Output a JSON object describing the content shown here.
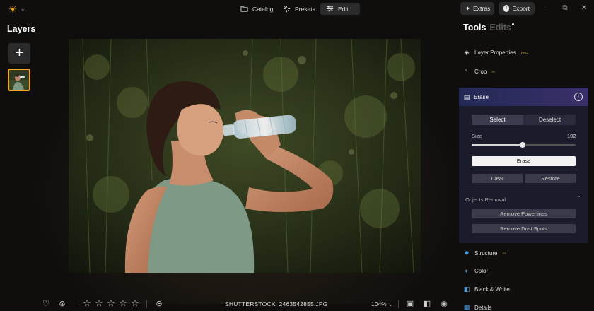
{
  "top_bar": {
    "tabs": [
      {
        "label": "Catalog",
        "icon": "folder-icon"
      },
      {
        "label": "Presets",
        "icon": "sparkle-icon"
      },
      {
        "label": "Edit",
        "icon": "sliders-icon",
        "active": true
      }
    ],
    "extras_label": "Extras",
    "export_label": "Export",
    "window_controls": [
      "minimize",
      "restore",
      "close"
    ]
  },
  "left_panel": {
    "title": "Layers",
    "add_label": "+"
  },
  "bottom_bar": {
    "filename": "SHUTTERSTOCK_2463542855.JPG",
    "zoom": "104%",
    "rating": 0,
    "rating_max": 5
  },
  "right_panel": {
    "tools_title": "Tools",
    "edits_title": "Edits",
    "tools_top": [
      {
        "label": "Layer Properties",
        "badge": "PRO",
        "icon": "layers-icon"
      },
      {
        "label": "Crop",
        "badge": "AI",
        "icon": "crop-icon"
      }
    ],
    "erase": {
      "title": "Erase",
      "select_label": "Select",
      "deselect_label": "Deselect",
      "size_label": "Size",
      "size_value": "102",
      "size_fraction": 0.49,
      "erase_button": "Erase",
      "clear_button": "Clear",
      "restore_button": "Restore",
      "objects_removal_title": "Objects Removal",
      "remove_powerlines": "Remove Powerlines",
      "remove_dust": "Remove Dust Spots"
    },
    "tools_bottom": [
      {
        "label": "Structure",
        "badge": "AI",
        "icon": "structure-icon"
      },
      {
        "label": "Color",
        "badge": "",
        "icon": "color-icon"
      },
      {
        "label": "Black & White",
        "badge": "",
        "icon": "bw-icon"
      },
      {
        "label": "Details",
        "badge": "",
        "icon": "details-icon"
      }
    ]
  },
  "colors": {
    "accent": "#f5a623",
    "panel_bg": "#1a1b2b",
    "tool_icon_blue": "#4a9de0"
  }
}
